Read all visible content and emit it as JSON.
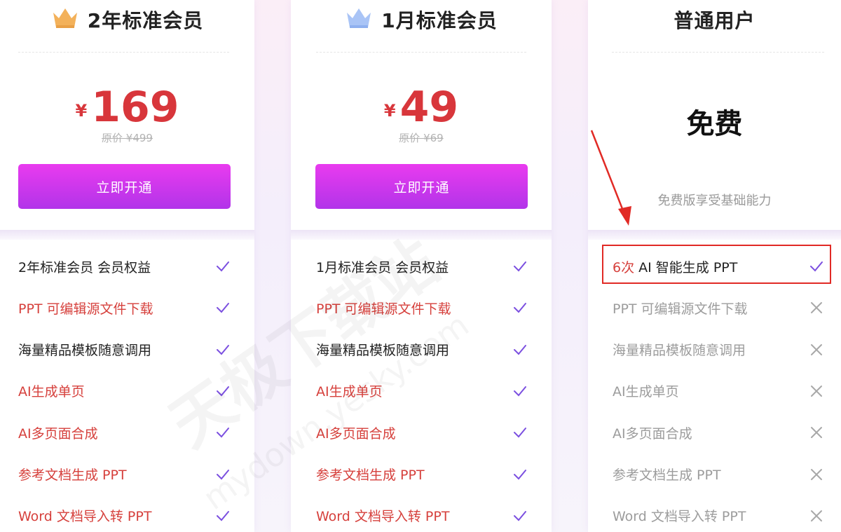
{
  "plans": [
    {
      "title": "2年标准会员",
      "crown_color": "#f3b15a",
      "currency": "¥",
      "price": "169",
      "original_price": "原价 ¥499",
      "button_label": "立即开通",
      "features": [
        {
          "label": "2年标准会员 会员权益",
          "tone": "black",
          "status": "check"
        },
        {
          "label": "PPT 可编辑源文件下载",
          "tone": "red",
          "status": "check"
        },
        {
          "label": "海量精品模板随意调用",
          "tone": "black",
          "status": "check"
        },
        {
          "label": "AI生成单页",
          "tone": "red",
          "status": "check"
        },
        {
          "label": "AI多页面合成",
          "tone": "red",
          "status": "check"
        },
        {
          "label": "参考文档生成 PPT",
          "tone": "red",
          "status": "check"
        },
        {
          "label": "Word 文档导入转 PPT",
          "tone": "red",
          "status": "check"
        }
      ]
    },
    {
      "title": "1月标准会员",
      "crown_color": "#a9c4f6",
      "currency": "¥",
      "price": "49",
      "original_price": "原价 ¥69",
      "button_label": "立即开通",
      "features": [
        {
          "label": "1月标准会员 会员权益",
          "tone": "black",
          "status": "check"
        },
        {
          "label": "PPT 可编辑源文件下载",
          "tone": "red",
          "status": "check"
        },
        {
          "label": "海量精品模板随意调用",
          "tone": "black",
          "status": "check"
        },
        {
          "label": "AI生成单页",
          "tone": "red",
          "status": "check"
        },
        {
          "label": "AI多页面合成",
          "tone": "red",
          "status": "check"
        },
        {
          "label": "参考文档生成 PPT",
          "tone": "red",
          "status": "check"
        },
        {
          "label": "Word 文档导入转 PPT",
          "tone": "red",
          "status": "check"
        }
      ]
    },
    {
      "title": "普通用户",
      "price_text": "免费",
      "description": "免费版享受基础能力",
      "features": [
        {
          "label_prefix": "6次",
          "label": " AI 智能生成 PPT",
          "tone": "black",
          "status": "check"
        },
        {
          "label": "PPT 可编辑源文件下载",
          "tone": "gray",
          "status": "cross"
        },
        {
          "label": "海量精品模板随意调用",
          "tone": "gray",
          "status": "cross"
        },
        {
          "label": "AI生成单页",
          "tone": "gray",
          "status": "cross"
        },
        {
          "label": "AI多页面合成",
          "tone": "gray",
          "status": "cross"
        },
        {
          "label": "参考文档生成 PPT",
          "tone": "gray",
          "status": "cross"
        },
        {
          "label": "Word 文档导入转 PPT",
          "tone": "gray",
          "status": "cross"
        }
      ]
    }
  ],
  "colors": {
    "price_red": "#d8363b",
    "check_purple": "#7b4fe0",
    "cross_gray": "#a8a8a8",
    "button_top": "#e93bef",
    "button_bottom": "#b234e9",
    "annotation_red": "#e12a25"
  },
  "icons": {
    "crown": "crown-icon",
    "check": "check-icon",
    "cross": "close-icon",
    "annotation_arrow": "arrow-icon"
  },
  "watermark": {
    "line1": "天极下载站",
    "line2": "mydown.yesky.com"
  }
}
